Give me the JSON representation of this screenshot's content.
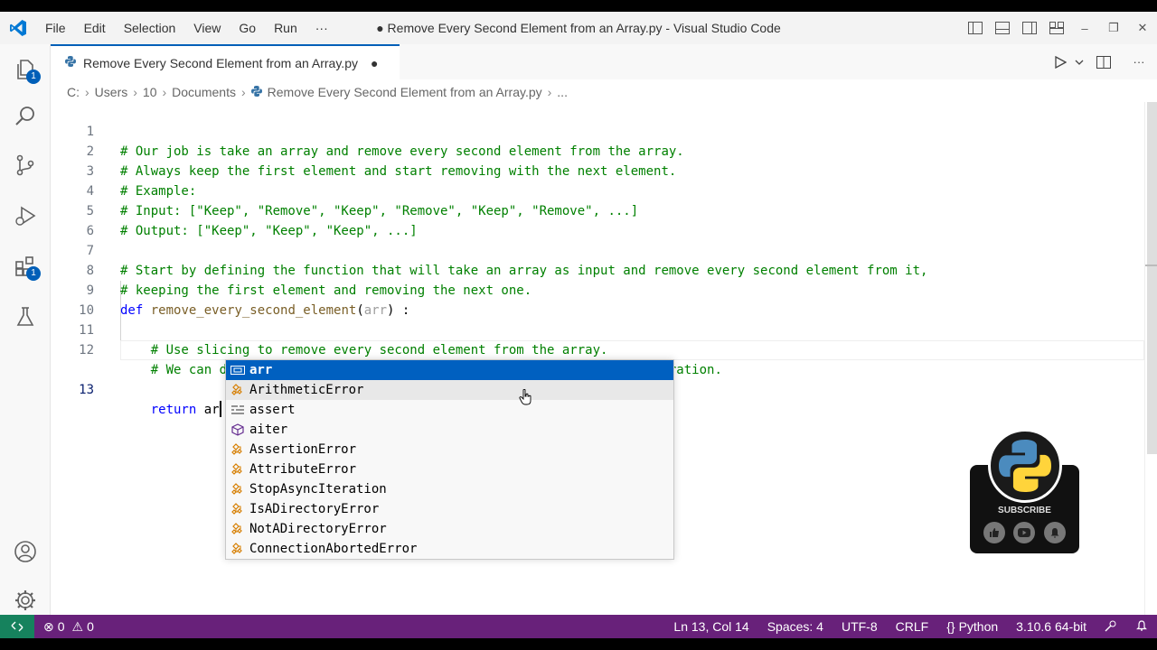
{
  "window": {
    "title": "● Remove Every Second Element from an Array.py - Visual Studio Code"
  },
  "menu": [
    "File",
    "Edit",
    "Selection",
    "View",
    "Go",
    "Run",
    "···"
  ],
  "activity_bar": {
    "explorer_badge": "1",
    "extensions_badge": "1"
  },
  "tab": {
    "label": "Remove Every Second Element from an Array.py",
    "dirty_marker": "●"
  },
  "breadcrumb": [
    "C:",
    "Users",
    "10",
    "Documents",
    "Remove Every Second Element from an Array.py",
    "..."
  ],
  "code_lines": [
    {
      "n": "1",
      "text": "# Our job is take an array and remove every second element from the array."
    },
    {
      "n": "2",
      "text": "# Always keep the first element and start removing with the next element."
    },
    {
      "n": "3",
      "text": "# Example:"
    },
    {
      "n": "4",
      "text": "# Input: [\"Keep\", \"Remove\", \"Keep\", \"Remove\", \"Keep\", \"Remove\", ...]"
    },
    {
      "n": "5",
      "text": "# Output: [\"Keep\", \"Keep\", \"Keep\", ...]"
    },
    {
      "n": "6",
      "text": ""
    },
    {
      "n": "7",
      "text": "# Start by defining the function that will take an array as input and remove every second element from it,"
    },
    {
      "n": "8",
      "text": "# keeping the first element and removing the next one."
    },
    {
      "n": "9",
      "kw": "def",
      "fn": "remove_every_second_element",
      "open": "(",
      "param": "arr",
      "close": ") :"
    },
    {
      "n": "10",
      "text": ""
    },
    {
      "n": "11",
      "text": "    # Use slicing to remove every second element from the array."
    },
    {
      "n": "12",
      "text": "    # We can do this by specifying the step size of 2 in the slicing operation."
    },
    {
      "n": "13",
      "kw": "return",
      "typed": "ar"
    }
  ],
  "suggestions": [
    {
      "pre": "",
      "m1": "ar",
      "post": "r",
      "icon": "variable-icon",
      "selected": true
    },
    {
      "pre": "",
      "m1": "A",
      "mid": "",
      "m2": "r",
      "post": "ithmeticError",
      "icon": "class-icon"
    },
    {
      "pre": "",
      "m1": "a",
      "mid": "sse",
      "m2": "r",
      "post": "t",
      "icon": "keyword-icon"
    },
    {
      "pre": "",
      "m1": "a",
      "mid": "ite",
      "m2": "r",
      "post": "",
      "icon": "function-icon"
    },
    {
      "pre": "",
      "m1": "A",
      "mid": "ssertionE",
      "m2": "r",
      "post": "ror",
      "icon": "class-icon"
    },
    {
      "pre": "",
      "m1": "A",
      "mid": "ttributeE",
      "m2": "r",
      "post": "ror",
      "icon": "class-icon"
    },
    {
      "pre": "StopAsync",
      "m1": "",
      "mid": "",
      "m2": "",
      "post": "",
      "icon": "class-icon",
      "raw": [
        "StopAsyncItera",
        "tion"
      ],
      "rawmatch": [
        "StopAsync",
        "",
        "Ite",
        "r",
        "ation"
      ]
    },
    {
      "icon": "class-icon",
      "parts": [
        "Is",
        "A",
        "DirectoryE",
        "r",
        "ror"
      ]
    },
    {
      "icon": "class-icon",
      "parts": [
        "Not",
        "A",
        "DirectoryE",
        "r",
        "ror"
      ]
    },
    {
      "icon": "class-icon",
      "parts": [
        "Connection",
        "A",
        "bortedE",
        "r",
        "ror"
      ]
    }
  ],
  "suggestion_labels": [
    "arr",
    "ArithmeticError",
    "assert",
    "aiter",
    "AssertionError",
    "AttributeError",
    "StopAsyncIteration",
    "IsADirectoryError",
    "NotADirectoryError",
    "ConnectionAbortedError"
  ],
  "subscribe": {
    "label": "SUBSCRIBE"
  },
  "status": {
    "errors": "0",
    "warnings": "0",
    "position": "Ln 13, Col 14",
    "spaces": "Spaces: 4",
    "encoding": "UTF-8",
    "eol": "CRLF",
    "language": "Python",
    "interpreter": "3.10.6 64-bit"
  },
  "colors": {
    "accent": "#005fb8",
    "statusbar": "#68217a",
    "remote": "#16825d",
    "selection": "#0060c0",
    "comment": "#008000",
    "keyword": "#0000ff"
  }
}
